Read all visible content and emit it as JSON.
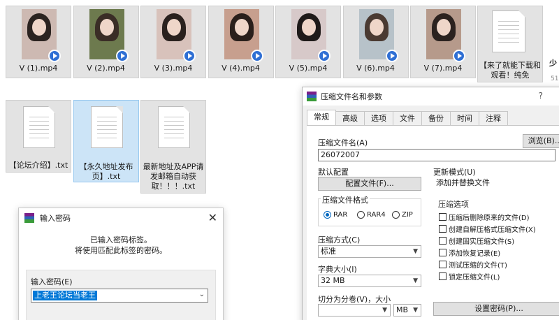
{
  "videos": [
    {
      "name": "V (1).mp4",
      "bg": "#cdb9b2",
      "hair": "#2b2320"
    },
    {
      "name": "V (2).mp4",
      "bg": "#6d7a4e",
      "hair": "#3a2d26"
    },
    {
      "name": "V (3).mp4",
      "bg": "#d8c2bb",
      "hair": "#2a211e"
    },
    {
      "name": "V (4).mp4",
      "bg": "#c79f8e",
      "hair": "#2a1f1b"
    },
    {
      "name": "V (5).mp4",
      "bg": "#d7c9c9",
      "hair": "#1f1a19"
    },
    {
      "name": "V (6).mp4",
      "bg": "#b7c2c9",
      "hair": "#4a3a32"
    },
    {
      "name": "V (7).mp4",
      "bg": "#b69a8b",
      "hair": "#2b221f"
    }
  ],
  "text_files": {
    "row1_doc": "【来了就能下载和观看！纯免",
    "forum_intro": "【论坛介绍】.txt",
    "perm_address": "【永久地址发布页】.txt",
    "latest_address": "最新地址及APP请发邮箱自动获取！！！.txt"
  },
  "edge_text": {
    "top": "少",
    "sub": "51"
  },
  "password_dialog": {
    "title": "输入密码",
    "close_glyph": "✕",
    "message_line1": "已输入密码标签。",
    "message_line2": "将使用匹配此标签的密码。",
    "input_label": "输入密码(E)",
    "input_value": "上老王论坛当老王",
    "arrow_glyph": "⌄"
  },
  "archive_dialog": {
    "title": "压缩文件名和参数",
    "help": "?",
    "tabs": [
      "常规",
      "高级",
      "选项",
      "文件",
      "备份",
      "时间",
      "注释"
    ],
    "archive_name_label": "压缩文件名(A)",
    "archive_name_value": "26072007",
    "browse_button": "浏览(B)...",
    "default_profile_label": "默认配置",
    "profiles_button": "配置文件(F)...",
    "update_mode_label": "更新模式(U)",
    "update_mode_value": "添加并替换文件",
    "format_group": "压缩文件格式",
    "formats": [
      "RAR",
      "RAR4",
      "ZIP"
    ],
    "selected_format": "RAR",
    "method_label": "压缩方式(C)",
    "method_value": "标准",
    "dict_label": "字典大小(I)",
    "dict_value": "32 MB",
    "split_label": "切分为分卷(V)，大小",
    "split_unit": "MB",
    "options_group": "压缩选项",
    "options": [
      "压缩后删除原来的文件(D)",
      "创建自解压格式压缩文件(X)",
      "创建固实压缩文件(S)",
      "添加恢复记录(E)",
      "测试压缩的文件(T)",
      "锁定压缩文件(L)"
    ],
    "set_password_button": "设置密码(P)..."
  },
  "colors": {
    "accent": "#0078d7",
    "selected_tile": "#cce4f7",
    "play_badge": "#2f6fd4"
  }
}
